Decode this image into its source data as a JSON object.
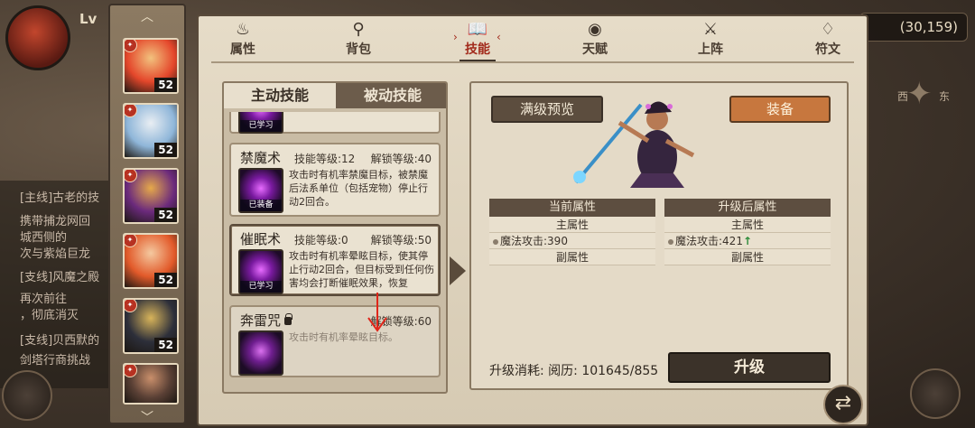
{
  "background": {
    "player_level_fragment": "Lv",
    "coordinates": "(30,159)",
    "compass": {
      "west": "西",
      "east": "东"
    },
    "quest_lines": [
      {
        "text": "[主线]古老的技",
        "style": "normal"
      },
      {
        "text": "携带捕龙网回",
        "style": "normal"
      },
      {
        "text": "城西侧的",
        "style": "normal"
      },
      {
        "text": "次与紫焰巨龙",
        "style": "normal"
      },
      {
        "text": "[支线]风魔之殿",
        "style": "normal"
      },
      {
        "text": "再次前往",
        "style": "normal"
      },
      {
        "text": "，彻底消灭",
        "style": "normal"
      },
      {
        "text": "[支线]贝西默的",
        "style": "normal"
      },
      {
        "text": "剑塔行商挑战",
        "style": "normal"
      }
    ]
  },
  "heroes": [
    {
      "level": "52",
      "colors": [
        "#e4472b",
        "#f2c27e"
      ],
      "selected": false
    },
    {
      "level": "52",
      "colors": [
        "#8fb6d9",
        "#e9eef3"
      ],
      "selected": false
    },
    {
      "level": "52",
      "colors": [
        "#6b2a7c",
        "#e6a94a"
      ],
      "selected": true
    },
    {
      "level": "52",
      "colors": [
        "#e25a2a",
        "#f4c9a0"
      ],
      "selected": false
    },
    {
      "level": "52",
      "colors": [
        "#2d2f3a",
        "#d8b45a"
      ],
      "selected": false
    },
    {
      "level": "",
      "colors": [
        "#5a4035",
        "#c98f6b"
      ],
      "selected": false
    }
  ],
  "tabs": [
    {
      "label": "属性",
      "icon": "flame-icon",
      "glyph": "♨",
      "active": false
    },
    {
      "label": "背包",
      "icon": "backpack-icon",
      "glyph": "⚲",
      "active": false
    },
    {
      "label": "技能",
      "icon": "book-icon",
      "glyph": "📖",
      "active": true
    },
    {
      "label": "天赋",
      "icon": "eye-icon",
      "glyph": "◉",
      "active": false
    },
    {
      "label": "上阵",
      "icon": "crossed-swords-icon",
      "glyph": "⚔",
      "active": false
    },
    {
      "label": "符文",
      "icon": "rune-stone-icon",
      "glyph": "♢",
      "active": false
    }
  ],
  "skill_tabs": {
    "active": "主动技能",
    "inactive": "被动技能"
  },
  "skills": [
    {
      "name": "",
      "level_text": "",
      "unlock_text": "",
      "desc": "。",
      "tag": "已学习",
      "locked": false,
      "partial": true
    },
    {
      "name": "禁魔术",
      "level_text": "技能等级:12",
      "unlock_text": "解锁等级:40",
      "desc": "攻击时有机率禁魔目标，被禁魔后法系单位（包括宠物）停止行动2回合。",
      "tag": "已装备",
      "locked": false,
      "partial": false
    },
    {
      "name": "催眠术",
      "level_text": "技能等级:0",
      "unlock_text": "解锁等级:50",
      "desc": "攻击时有机率晕眩目标，使其停止行动2回合，但目标受到任何伤害均会打断催眠效果，恢复",
      "tag": "已学习",
      "locked": false,
      "partial": false
    },
    {
      "name": "奔雷咒",
      "level_text": "",
      "unlock_text": "解锁等级:60",
      "desc": "攻击时有机率晕眩目标。",
      "tag": "",
      "locked": true,
      "partial": false
    }
  ],
  "buttons": {
    "preview": "满级预览",
    "equip": "装备",
    "upgrade": "升级",
    "swap": "⇄"
  },
  "current_attrs": {
    "header": "当前属性",
    "main_label": "主属性",
    "main_stat": "魔法攻击:390",
    "sub_label": "副属性"
  },
  "upgraded_attrs": {
    "header": "升级后属性",
    "main_label": "主属性",
    "main_stat": "魔法攻击:421",
    "sub_label": "副属性"
  },
  "upgrade_cost": "升级消耗: 阅历: 101645/855"
}
